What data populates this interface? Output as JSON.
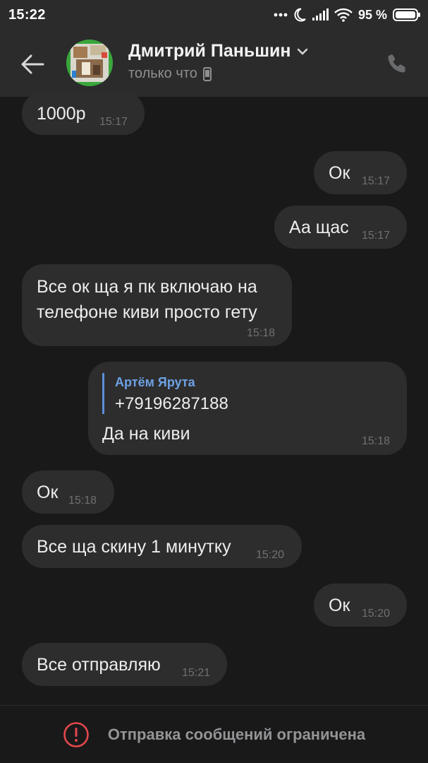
{
  "status_bar": {
    "time": "15:22",
    "battery_percent": "95 %"
  },
  "header": {
    "contact_name": "Дмитрий Паньшин",
    "contact_status": "только что"
  },
  "messages": [
    {
      "direction": "incoming",
      "text": "1000р",
      "time": "15:17"
    },
    {
      "direction": "outgoing",
      "text": "Ок",
      "time": "15:17"
    },
    {
      "direction": "outgoing",
      "text": "Аа щас",
      "time": "15:17"
    },
    {
      "direction": "incoming",
      "text_line1": "Все ок ща я пк включаю на",
      "text_line2": "телефоне киви просто гету",
      "time": "15:18"
    },
    {
      "direction": "outgoing",
      "reply_author": "Артём Ярута",
      "reply_text": "+79196287188",
      "text": "Да на киви",
      "time": "15:18"
    },
    {
      "direction": "incoming",
      "text": "Ок",
      "time": "15:18"
    },
    {
      "direction": "incoming",
      "text": "Все ща скину 1 минутку",
      "time": "15:20"
    },
    {
      "direction": "outgoing",
      "text": "Ок",
      "time": "15:20"
    },
    {
      "direction": "incoming",
      "text": "Все отправляю",
      "time": "15:21"
    }
  ],
  "footer": {
    "restricted_notice": "Отправка сообщений ограничена"
  },
  "colors": {
    "background": "#19191a",
    "bar": "#2b2b2c",
    "bubble": "#2d2d2e",
    "reply_accent": "#5b8fd6",
    "warning": "#e5474b"
  }
}
